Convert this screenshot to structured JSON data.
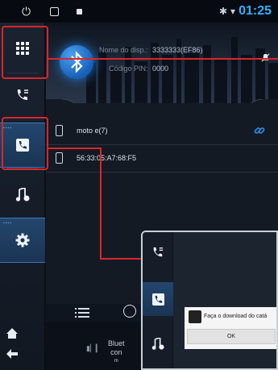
{
  "status_bar": {
    "time": "01:25"
  },
  "header": {
    "device_name_label": "Nome do disp.:",
    "device_name_value": "3333333(EF86)",
    "pin_label": "Código PIN:",
    "pin_value": "0000"
  },
  "devices": [
    {
      "name": "moto e(7)",
      "connected": true
    },
    {
      "name": "56:33:05:A7:68:F5",
      "connected": false
    }
  ],
  "bottom_bar": {
    "title_line1": "Bluet",
    "title_line2": "con",
    "title_line3": "m"
  },
  "inset_dialog": {
    "title": "Faça o download do catá",
    "ok_label": "OK"
  },
  "colors": {
    "accent": "#2fb2ff",
    "annotation": "#d9262b",
    "active": "#23466e"
  }
}
